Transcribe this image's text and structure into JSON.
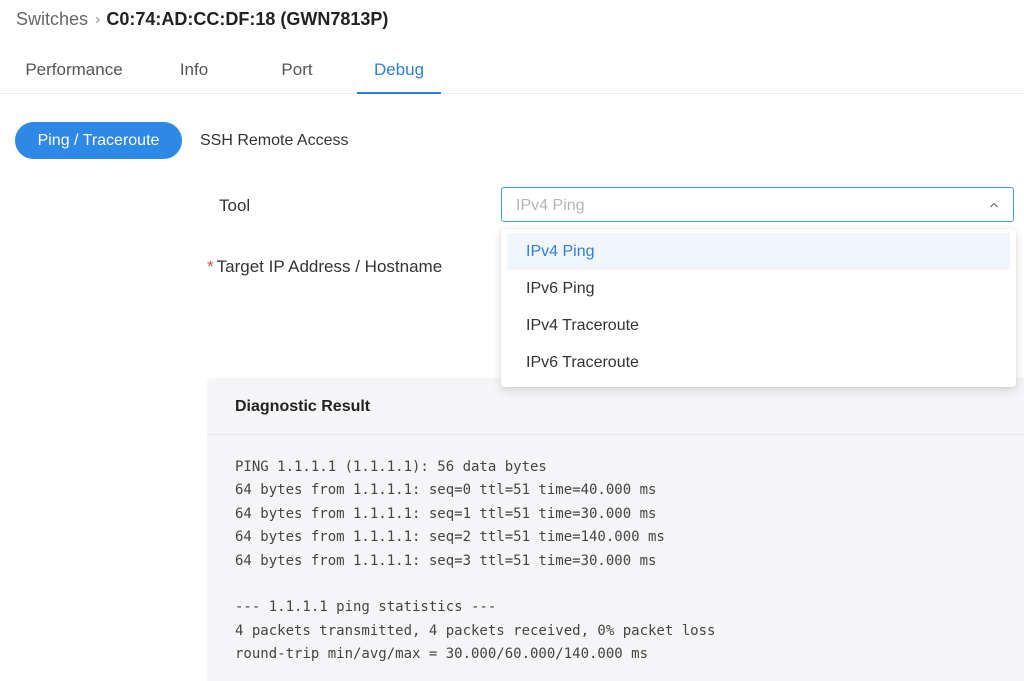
{
  "breadcrumb": {
    "parent": "Switches",
    "separator": "›",
    "current": "C0:74:AD:CC:DF:18 (GWN7813P)"
  },
  "tabs": [
    {
      "label": "Performance",
      "active": false
    },
    {
      "label": "Info",
      "active": false
    },
    {
      "label": "Port",
      "active": false
    },
    {
      "label": "Debug",
      "active": true
    }
  ],
  "subtabs": [
    {
      "label": "Ping / Traceroute",
      "active": true
    },
    {
      "label": "SSH Remote Access",
      "active": false
    }
  ],
  "form": {
    "tool_label": "Tool",
    "tool_value": "IPv4 Ping",
    "required_marker": "*",
    "target_label": "Target IP Address / Hostname"
  },
  "dropdown": {
    "options": [
      "IPv4 Ping",
      "IPv6 Ping",
      "IPv4 Traceroute",
      "IPv6 Traceroute"
    ],
    "selected": "IPv4 Ping"
  },
  "result": {
    "title": "Diagnostic Result",
    "output": "PING 1.1.1.1 (1.1.1.1): 56 data bytes\n64 bytes from 1.1.1.1: seq=0 ttl=51 time=40.000 ms\n64 bytes from 1.1.1.1: seq=1 ttl=51 time=30.000 ms\n64 bytes from 1.1.1.1: seq=2 ttl=51 time=140.000 ms\n64 bytes from 1.1.1.1: seq=3 ttl=51 time=30.000 ms\n\n--- 1.1.1.1 ping statistics ---\n4 packets transmitted, 4 packets received, 0% packet loss\nround-trip min/avg/max = 30.000/60.000/140.000 ms"
  },
  "icons": {
    "select_arrow": "chevron-up-icon",
    "breadcrumb_separator": "chevron-right-icon"
  },
  "colors": {
    "accent": "#2d88e6",
    "required": "#e34d4d",
    "result_bg": "#f5f5f7"
  }
}
